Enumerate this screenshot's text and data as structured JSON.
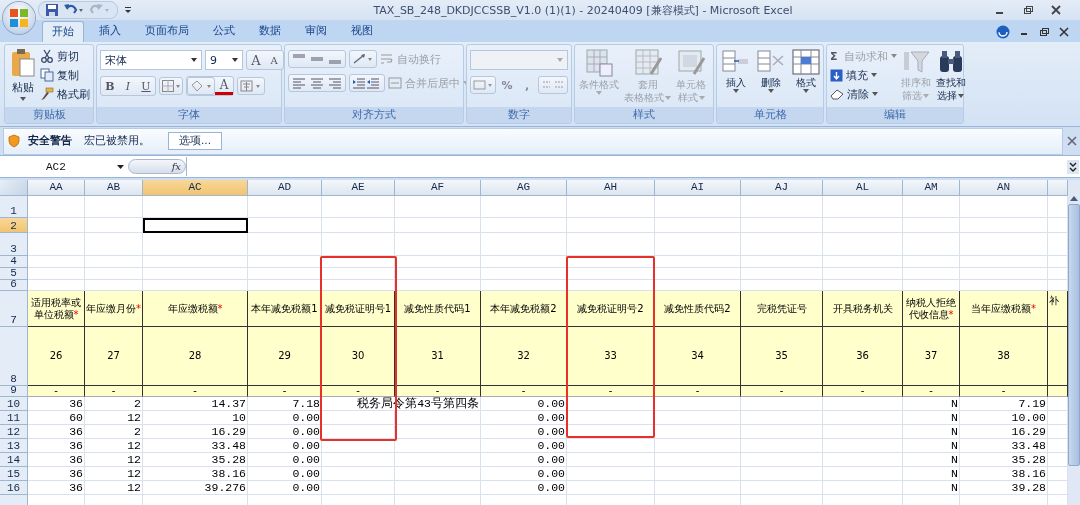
{
  "window": {
    "title": "TAX_SB_248_DKDJCCSSB_V1.0 (1)(1) - 20240409  [兼容模式] - Microsoft Excel"
  },
  "tabs": [
    {
      "label": "开始",
      "selected": true
    },
    {
      "label": "插入",
      "selected": false
    },
    {
      "label": "页面布局",
      "selected": false
    },
    {
      "label": "公式",
      "selected": false
    },
    {
      "label": "数据",
      "selected": false
    },
    {
      "label": "审阅",
      "selected": false
    },
    {
      "label": "视图",
      "selected": false
    }
  ],
  "ribbon": {
    "clipboard": {
      "label": "剪贴板",
      "paste": "粘贴",
      "cut": "剪切",
      "copy": "复制",
      "format_painter": "格式刷"
    },
    "font": {
      "label": "字体",
      "font_name": "宋体",
      "font_size": "9",
      "grow": "A",
      "shrink": "A",
      "bold": "B",
      "italic": "I",
      "underline": "U",
      "font_color": "A"
    },
    "alignment": {
      "label": "对齐方式",
      "wrap_text": {
        "text": "自动换行",
        "disabled": true
      },
      "merge": {
        "text": "合并后居中",
        "disabled": true
      }
    },
    "number": {
      "label": "数字",
      "percent": "%",
      "comma": ","
    },
    "styles": {
      "label": "样式",
      "buttons": [
        {
          "kind": "conditional",
          "lines": [
            "条件格式"
          ],
          "disabled": true
        },
        {
          "kind": "table",
          "lines": [
            "套用",
            "表格格式"
          ],
          "disabled": true
        },
        {
          "kind": "cellstyle",
          "lines": [
            "单元格",
            "样式"
          ],
          "disabled": true
        }
      ]
    },
    "cells": {
      "label": "单元格",
      "buttons": [
        {
          "kind": "insert",
          "lines": [
            "插入"
          ],
          "disabled": false
        },
        {
          "kind": "delete",
          "lines": [
            "删除"
          ],
          "disabled": false
        },
        {
          "kind": "format",
          "lines": [
            "格式"
          ],
          "disabled": false
        }
      ]
    },
    "editing": {
      "label": "编辑",
      "autosum": {
        "symbol": "Σ",
        "text": "自动求和",
        "disabled": true
      },
      "fill": "填充",
      "clear": "清除",
      "sort_filter": {
        "lines": [
          "排序和",
          "筛选"
        ],
        "disabled": true
      },
      "find_select": {
        "lines": [
          "查找和",
          "选择"
        ],
        "disabled": false
      }
    }
  },
  "security_bar": {
    "title": "安全警告",
    "message": "宏已被禁用。",
    "button": "选项..."
  },
  "formula_bar": {
    "name_box": "AC2",
    "fx": "fx"
  },
  "sheet": {
    "columns": [
      {
        "letter": "AA",
        "selected": false
      },
      {
        "letter": "AB",
        "selected": false
      },
      {
        "letter": "AC",
        "selected": true
      },
      {
        "letter": "AD",
        "selected": false
      },
      {
        "letter": "AE",
        "selected": false
      },
      {
        "letter": "AF",
        "selected": false
      },
      {
        "letter": "AG",
        "selected": false
      },
      {
        "letter": "AH",
        "selected": false
      },
      {
        "letter": "AI",
        "selected": false
      },
      {
        "letter": "AJ",
        "selected": false
      },
      {
        "letter": "AL",
        "selected": false
      },
      {
        "letter": "AM",
        "selected": false
      },
      {
        "letter": "AN",
        "selected": false
      }
    ],
    "rows": [
      {
        "label": "1",
        "kind": "blank",
        "selected": false
      },
      {
        "label": "2",
        "kind": "blank",
        "selected": true
      },
      {
        "label": "3",
        "kind": "blank",
        "selected": false
      },
      {
        "label": "4",
        "kind": "blank",
        "selected": false
      },
      {
        "label": "5",
        "kind": "blank",
        "selected": false
      },
      {
        "label": "6",
        "kind": "blank",
        "selected": false
      },
      {
        "label": "7",
        "kind": "title",
        "selected": false,
        "cells": [
          {
            "text": "适用税率或单位税额",
            "mark": "*"
          },
          {
            "text": "年应缴月份",
            "mark": "*"
          },
          {
            "text": "年应缴税额",
            "mark": "*"
          },
          {
            "text": "本年减免税额1"
          },
          {
            "text": "减免税证明号1"
          },
          {
            "text": "减免性质代码1"
          },
          {
            "text": "本年减免税额2"
          },
          {
            "text": "减免税证明号2"
          },
          {
            "text": "减免性质代码2"
          },
          {
            "text": "完税凭证号"
          },
          {
            "text": "开具税务机关"
          },
          {
            "text": "纳税人拒绝代收信息",
            "mark": "*"
          },
          {
            "text": "当年应缴税额",
            "mark": "*"
          },
          {
            "text": "补"
          }
        ]
      },
      {
        "label": "8",
        "kind": "number",
        "selected": false,
        "cells": [
          "26",
          "27",
          "28",
          "29",
          "30",
          "31",
          "32",
          "33",
          "34",
          "35",
          "36",
          "37",
          "38",
          null
        ]
      },
      {
        "label": "9",
        "kind": "dash",
        "selected": false,
        "cells": [
          "-",
          "-",
          "-",
          "-",
          "-",
          "-",
          "-",
          "-",
          "-",
          "-",
          "-",
          "-",
          "-",
          null
        ]
      },
      {
        "label": "10",
        "kind": "data",
        "selected": false,
        "cells": [
          "36",
          "2",
          "14.37",
          "7.18",
          {
            "text": "税务局令第43号第四条",
            "kind": "overflow"
          },
          null,
          "0.00",
          null,
          null,
          null,
          null,
          "N",
          "7.19",
          null
        ]
      },
      {
        "label": "11",
        "kind": "data",
        "selected": false,
        "cells": [
          "60",
          "12",
          "10",
          "0.00",
          null,
          null,
          "0.00",
          null,
          null,
          null,
          null,
          "N",
          "10.00",
          null
        ]
      },
      {
        "label": "12",
        "kind": "data",
        "selected": false,
        "cells": [
          "36",
          "2",
          "16.29",
          "0.00",
          null,
          null,
          "0.00",
          null,
          null,
          null,
          null,
          "N",
          "16.29",
          null
        ]
      },
      {
        "label": "13",
        "kind": "data",
        "selected": false,
        "cells": [
          "36",
          "12",
          "33.48",
          "0.00",
          null,
          null,
          "0.00",
          null,
          null,
          null,
          null,
          "N",
          "33.48",
          null
        ]
      },
      {
        "label": "14",
        "kind": "data",
        "selected": false,
        "cells": [
          "36",
          "12",
          "35.28",
          "0.00",
          null,
          null,
          "0.00",
          null,
          null,
          null,
          null,
          "N",
          "35.28",
          null
        ]
      },
      {
        "label": "15",
        "kind": "data",
        "selected": false,
        "cells": [
          "36",
          "12",
          "38.16",
          "0.00",
          null,
          null,
          "0.00",
          null,
          null,
          null,
          null,
          "N",
          "38.16",
          null
        ]
      },
      {
        "label": "16",
        "kind": "data",
        "selected": false,
        "cells": [
          "36",
          "12",
          "39.276",
          "0.00",
          null,
          null,
          "0.00",
          null,
          null,
          null,
          null,
          "N",
          "39.28",
          null
        ]
      }
    ]
  }
}
